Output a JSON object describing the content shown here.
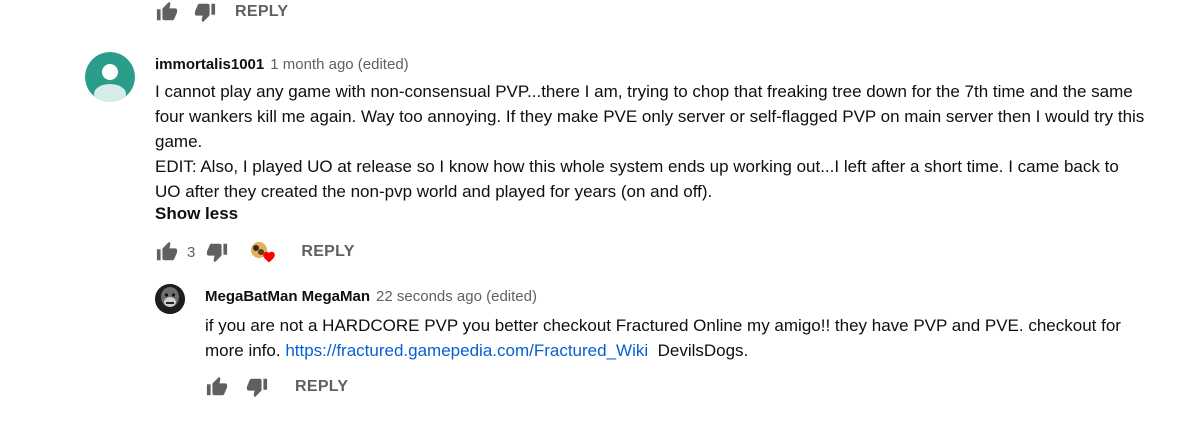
{
  "prev_actions": {
    "reply_label": "REPLY"
  },
  "comment": {
    "author": "immortalis1001",
    "time": "1 month ago (edited)",
    "avatar_color": "#2a9d8a",
    "lines": [
      "I cannot play any game with non-consensual PVP...there I am, trying to chop that freaking tree down for the 7th time and the same",
      "four wankers kill me again. Way too annoying. If they make PVE only server or self-flagged PVP on main server then I would try this",
      "game.",
      "EDIT: Also, I played UO at release so I know how this whole system ends up working out...I left after a short time. I came back to",
      "UO after they created the non-pvp world and played for years (on and off)."
    ],
    "show_less": "Show less",
    "like_count": "3",
    "reply_label": "REPLY"
  },
  "reply": {
    "author": "MegaBatMan MegaMan",
    "time": "22 seconds ago (edited)",
    "line1": "if you are not a HARDCORE PVP you better checkout Fractured Online my amigo!! they have PVP and PVE. checkout for",
    "line2_prefix": "more info. ",
    "link": "https://fractured.gamepedia.com/Fractured_Wiki",
    "line2_suffix": "  DevilsDogs.",
    "reply_label": "REPLY"
  }
}
